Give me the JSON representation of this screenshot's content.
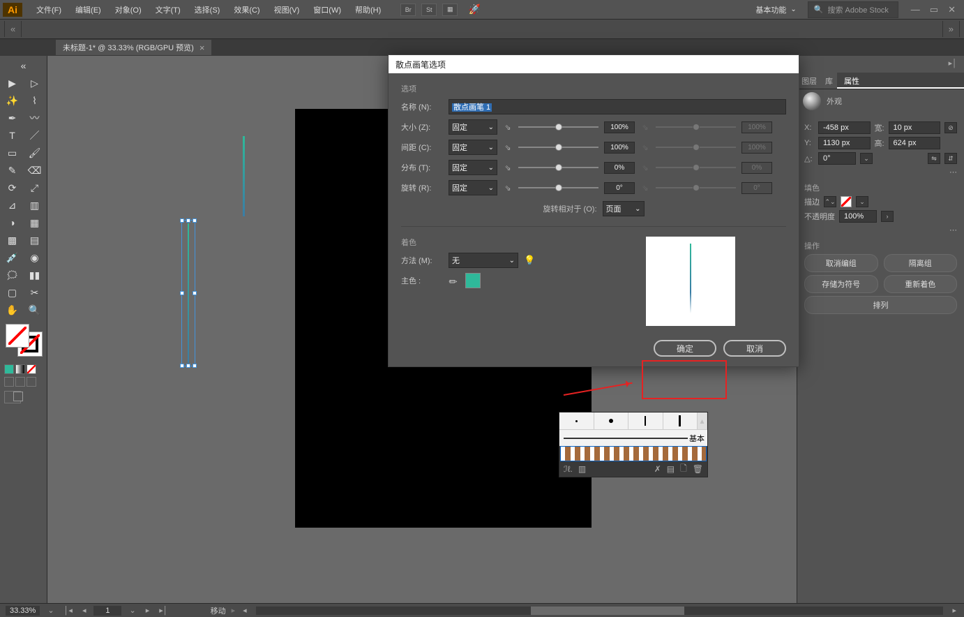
{
  "app": {
    "logo": "Ai"
  },
  "menu": {
    "file": "文件(F)",
    "edit": "编辑(E)",
    "object": "对象(O)",
    "type": "文字(T)",
    "select": "选择(S)",
    "effect": "效果(C)",
    "view": "视图(V)",
    "window": "窗口(W)",
    "help": "帮助(H)"
  },
  "topbar_icons": {
    "br": "Br",
    "st": "St"
  },
  "workspace": "基本功能",
  "search_placeholder": "搜索 Adobe Stock",
  "doc_tab": "未标题-1* @ 33.33% (RGB/GPU 预览)",
  "dialog": {
    "title": "散点画笔选项",
    "section_options": "选项",
    "name_label": "名称 (N):",
    "name_value": "散点画笔 1",
    "size_label": "大小 (Z):",
    "spacing_label": "间距 (C):",
    "scatter_label": "分布 (T):",
    "rotation_label": "旋转 (R):",
    "fixed": "固定",
    "none": "无",
    "v100": "100%",
    "v0": "0%",
    "deg0": "0°",
    "rotate_relative": "旋转相对于 (O):",
    "page": "页面",
    "section_color": "着色",
    "method_label": "方法 (M):",
    "keycolor_label": "主色 :",
    "ok": "确定",
    "cancel": "取消"
  },
  "right": {
    "tab_layers": "图层",
    "tab_libs": "库",
    "tab_props": "属性",
    "appearance_label": "外观",
    "x_lbl": "X:",
    "y_lbl": "Y:",
    "w_lbl": "宽:",
    "h_lbl": "高:",
    "x_val": "-458 px",
    "y_val": "1130 px",
    "w_val": "10 px",
    "h_val": "624 px",
    "angle_lbl": "△:",
    "angle_val": "0°",
    "fill_lbl": "填色",
    "stroke_lbl": "描边",
    "opacity_lbl": "不透明度",
    "opacity_val": "100%",
    "option_lbl": "操作",
    "btn_ungroup": "取消编组",
    "btn_isolate": "隔离组",
    "btn_save_symbol": "存储为符号",
    "btn_recolor": "重新着色",
    "btn_arrange": "排列"
  },
  "brushes": {
    "basic": "基本"
  },
  "status": {
    "zoom": "33.33%",
    "page": "1",
    "mode": "移动"
  }
}
